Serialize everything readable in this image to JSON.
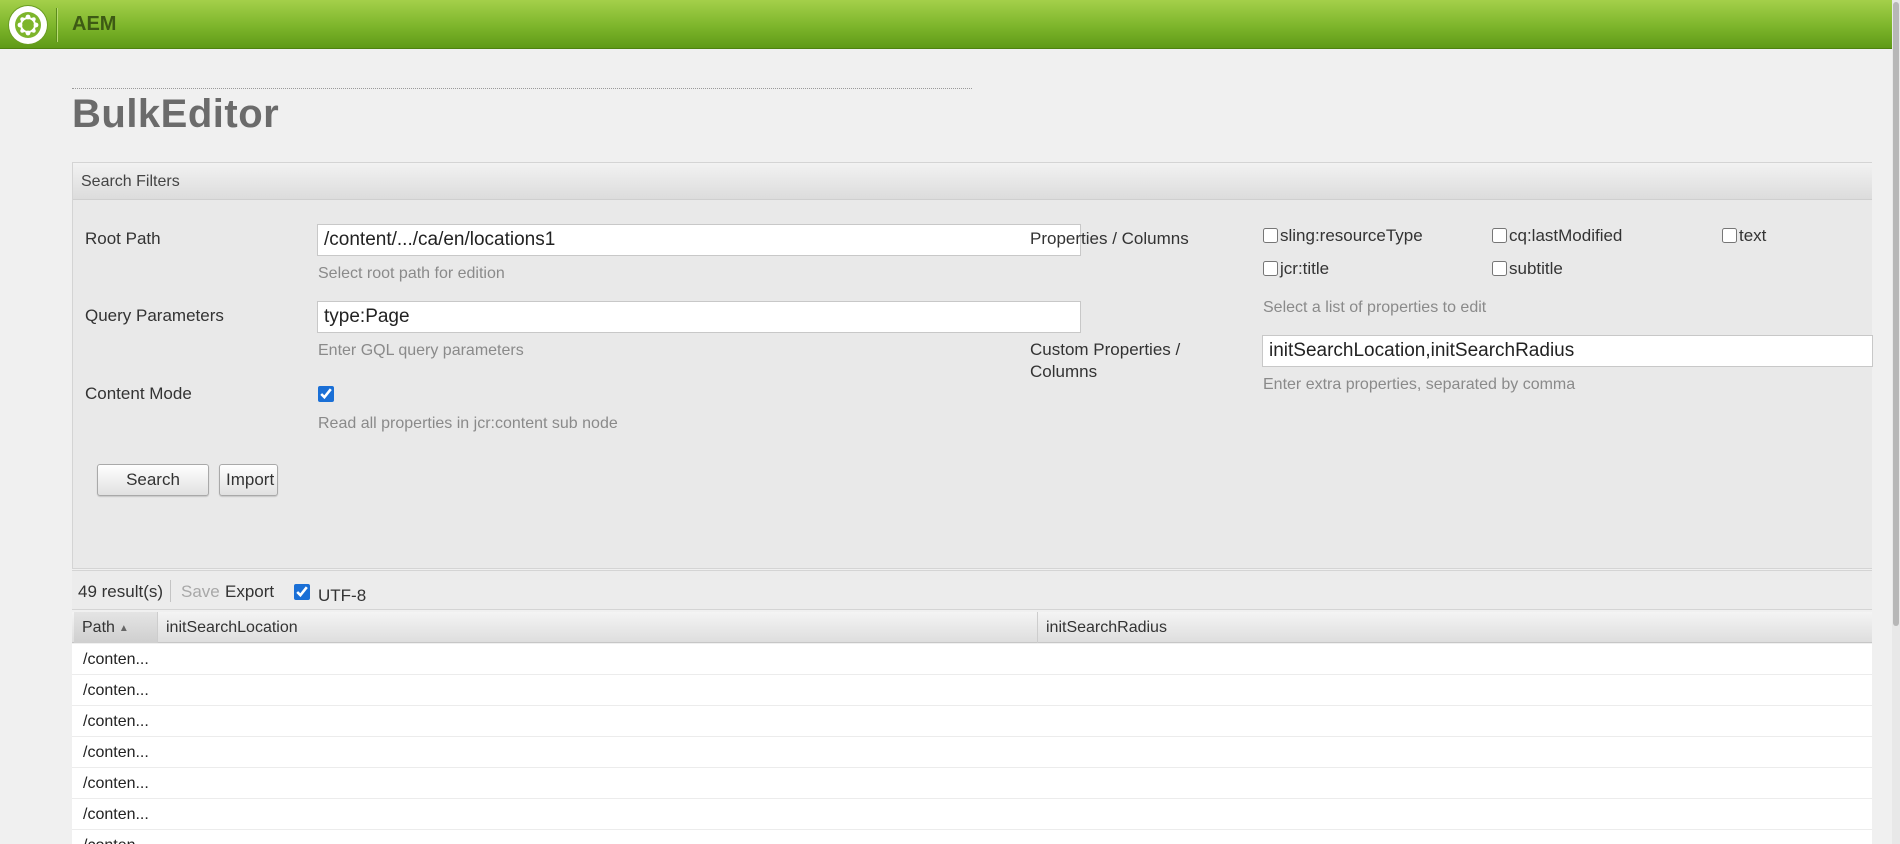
{
  "header": {
    "app_title": "AEM",
    "logo_icon": "aem-logo-icon",
    "brand_color": "#7db52b"
  },
  "page": {
    "title": "BulkEditor"
  },
  "filters": {
    "panel_title": "Search Filters",
    "root_path": {
      "label": "Root Path",
      "value": "/content/.../ca/en/locations1",
      "help": "Select root path for edition"
    },
    "query_parameters": {
      "label": "Query Parameters",
      "value": "type:Page",
      "help": "Enter GQL query parameters"
    },
    "content_mode": {
      "label": "Content Mode",
      "checked": true,
      "help": "Read all properties in jcr:content sub node"
    },
    "properties": {
      "label": "Properties / Columns",
      "options": [
        {
          "label": "sling:resourceType",
          "checked": false
        },
        {
          "label": "cq:lastModified",
          "checked": false
        },
        {
          "label": "text",
          "checked": false
        },
        {
          "label": "jcr:title",
          "checked": false
        },
        {
          "label": "subtitle",
          "checked": false
        }
      ],
      "help": "Select a list of properties to edit"
    },
    "custom_properties": {
      "label_line1": "Custom Properties /",
      "label_line2": "Columns",
      "value": "initSearchLocation,initSearchRadius",
      "help": "Enter extra properties, separated by comma"
    },
    "search_button": "Search",
    "import_button": "Import"
  },
  "results": {
    "count_text": "49 result(s)",
    "save_label": "Save",
    "export_label": "Export",
    "utf8_label": "UTF-8",
    "utf8_checked": true,
    "columns": [
      {
        "label": "Path",
        "sorted": "asc"
      },
      {
        "label": "initSearchLocation"
      },
      {
        "label": "initSearchRadius"
      }
    ],
    "rows": [
      {
        "path": "/conten..."
      },
      {
        "path": "/conten..."
      },
      {
        "path": "/conten..."
      },
      {
        "path": "/conten..."
      },
      {
        "path": "/conten..."
      },
      {
        "path": "/conten..."
      },
      {
        "path": "/conten..."
      }
    ]
  }
}
